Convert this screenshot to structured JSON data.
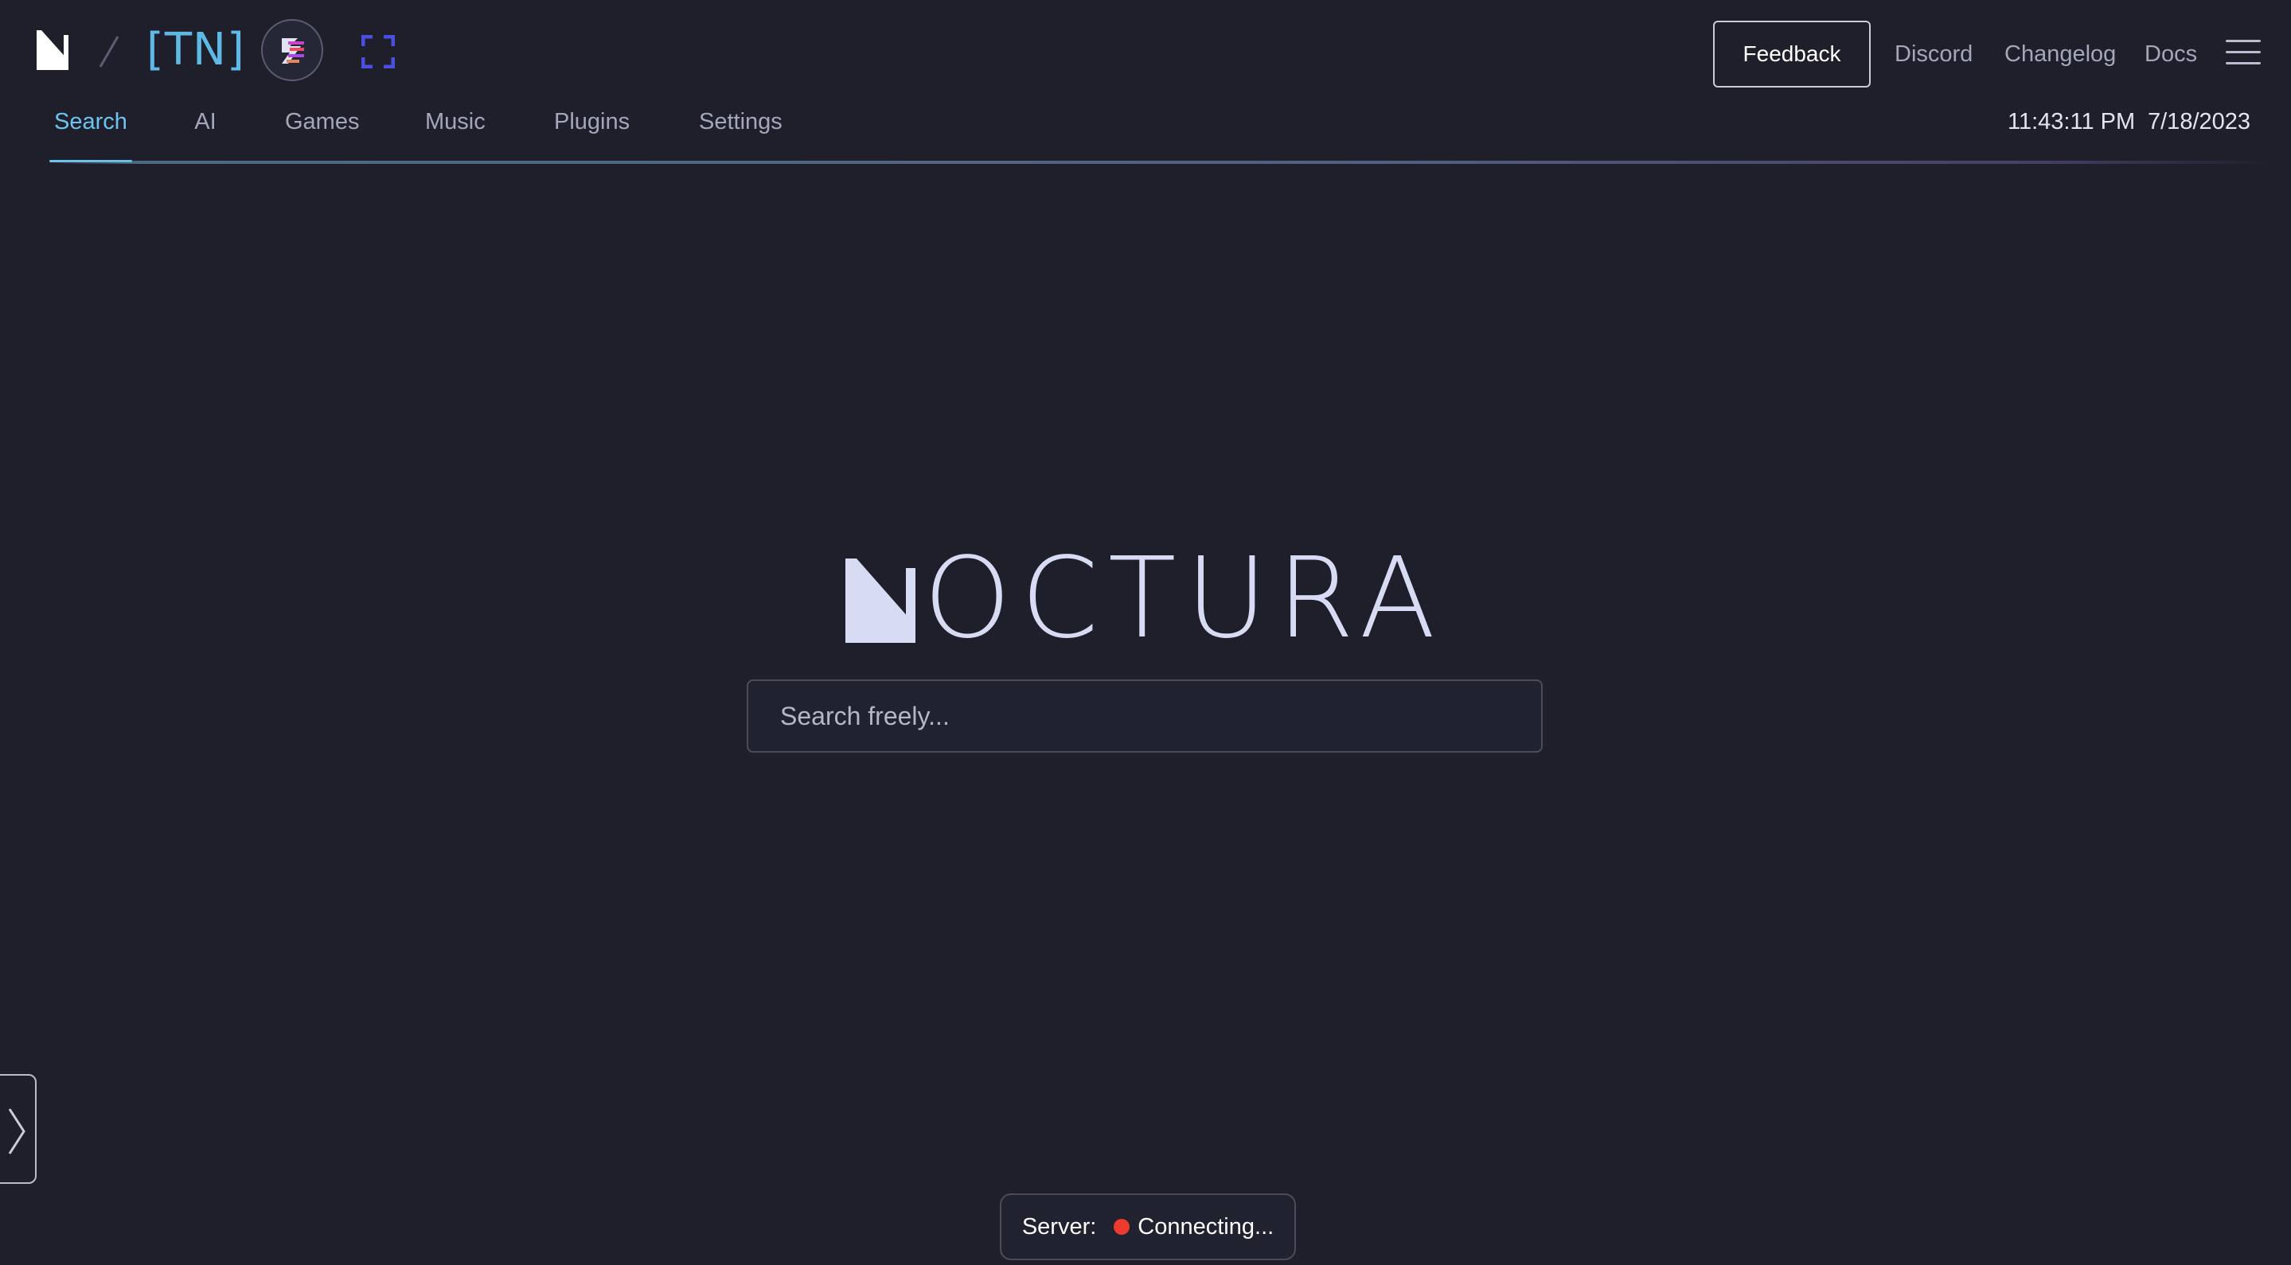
{
  "header": {
    "tn_logo_text": "[TN]",
    "feedback_label": "Feedback",
    "links": {
      "discord": "Discord",
      "changelog": "Changelog",
      "docs": "Docs"
    },
    "time": "11:43:11 PM",
    "date": "7/18/2023"
  },
  "tabs": [
    {
      "label": "Search",
      "active": true
    },
    {
      "label": "AI",
      "active": false
    },
    {
      "label": "Games",
      "active": false
    },
    {
      "label": "Music",
      "active": false
    },
    {
      "label": "Plugins",
      "active": false
    },
    {
      "label": "Settings",
      "active": false
    }
  ],
  "hero": {
    "wordmark": "OCTURA",
    "search_placeholder": "Search freely..."
  },
  "status": {
    "server_label": "Server:",
    "server_state": "Connecting...",
    "state_color": "#ee3b2f"
  },
  "colors": {
    "background": "#1f1f2c",
    "accent": "#6cc4ef",
    "fullscreen_icon": "#4a4fe0"
  },
  "icons": {
    "brand": "noctura-n-icon",
    "fullscreen": "fullscreen-icon",
    "menu": "hamburger-menu-icon",
    "sidebar_toggle": "chevron-right-icon"
  }
}
